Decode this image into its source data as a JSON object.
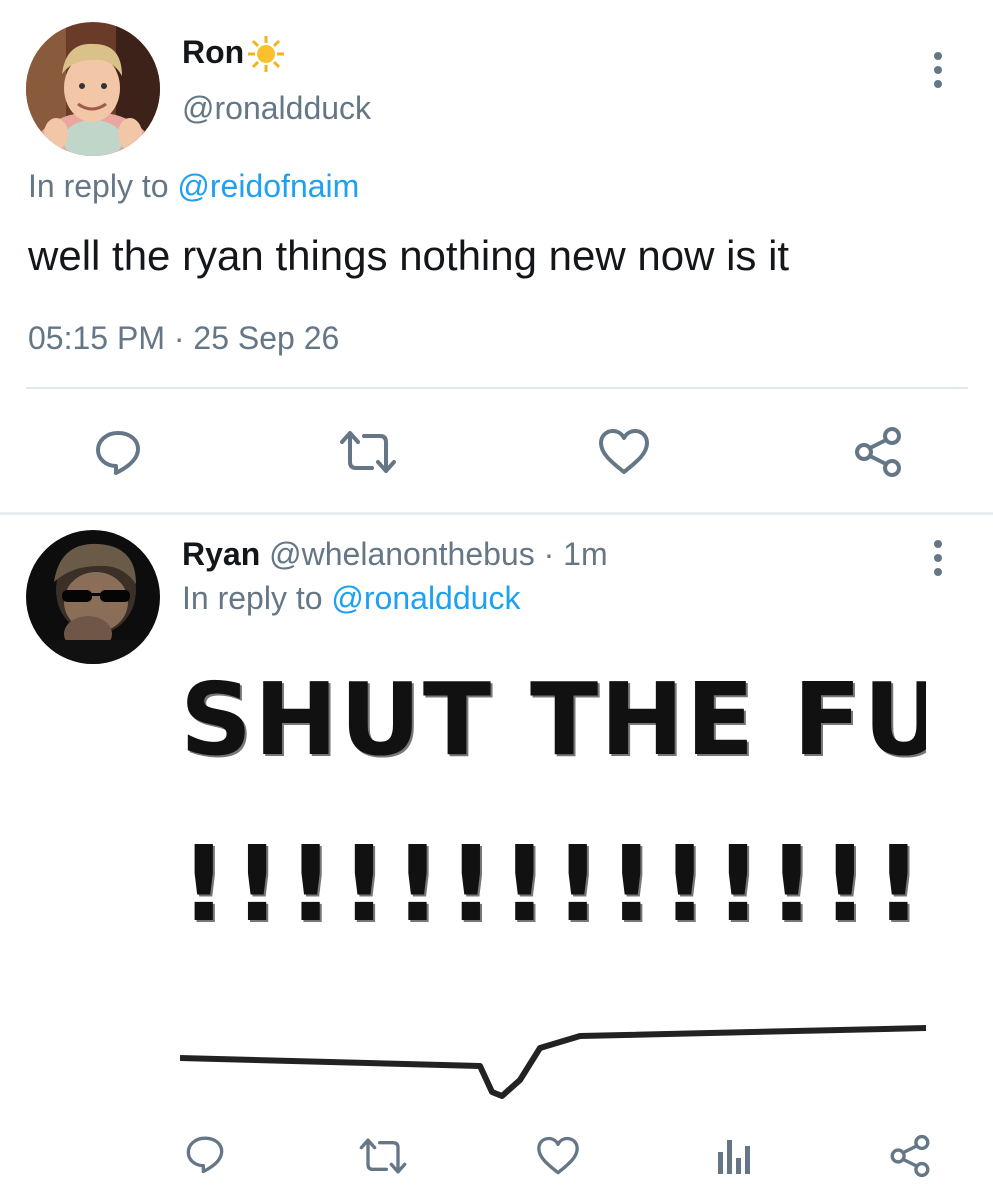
{
  "tweet1": {
    "name": "Ron",
    "emoji": "☀️",
    "handle": "@ronaldduck",
    "reply_prefix": "In reply to",
    "reply_handle": "@reidofnaim",
    "text": "well the ryan things nothing new now is it",
    "time": "05:15 PM",
    "date_sep": "·",
    "date": "25 Sep 26",
    "actions": [
      "reply-icon",
      "retweet-icon",
      "like-icon",
      "share-icon"
    ]
  },
  "tweet2": {
    "name": "Ryan",
    "handle": "@whelanonthebus",
    "meta": "· 1m",
    "reply_prefix": "In reply to",
    "reply_handle": "@ronaldduck",
    "image": {
      "line1": "SHUT THE FU",
      "line2": "!!!!!!!!!!!!!!!!!!!!"
    },
    "actions": [
      "reply-icon",
      "retweet-icon",
      "like-icon",
      "analytics-icon",
      "share-icon"
    ]
  },
  "colors": {
    "text": "#14171a",
    "muted": "#657786",
    "link": "#1da1f2",
    "divider": "#e1e8ed"
  }
}
